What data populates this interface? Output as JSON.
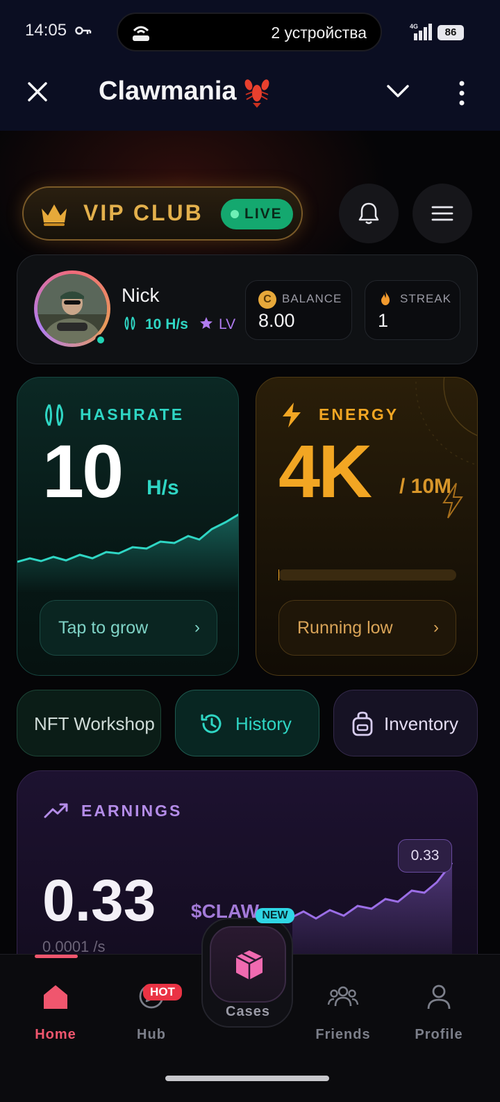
{
  "status_bar": {
    "time": "14:05",
    "devices_text": "2 устройства",
    "network": "4G",
    "battery": "86"
  },
  "app_header": {
    "title": "Clawmania",
    "emoji_icon": "lobster-icon"
  },
  "vip": {
    "label": "VIP CLUB",
    "live_label": "LIVE"
  },
  "profile": {
    "name": "Nick",
    "hashrate": "10 H/s",
    "level": "LV",
    "balance_label": "BALANCE",
    "balance_value": "8.00",
    "streak_label": "STREAK",
    "streak_value": "1",
    "coin_letter": "C"
  },
  "hashrate_card": {
    "label": "HASHRATE",
    "value": "10",
    "unit": "H/s",
    "action_label": "Tap to grow",
    "arrow": "›"
  },
  "energy_card": {
    "label": "ENERGY",
    "value": "4K",
    "max": "/ 10M",
    "level_fraction": 0.0004,
    "action_label": "Running low",
    "arrow": "›"
  },
  "quick_actions": [
    {
      "label": "NFT Workshop"
    },
    {
      "label": "History"
    },
    {
      "label": "Inventory"
    }
  ],
  "earnings": {
    "label": "EARNINGS",
    "value": "0.33",
    "unit": "$CLAW",
    "rate": "0.0001 /s",
    "badge": "0.33"
  },
  "nav": {
    "home": "Home",
    "hub": "Hub",
    "hot_badge": "HOT",
    "cases": "Cases",
    "new_badge": "NEW",
    "friends": "Friends",
    "profile": "Profile"
  },
  "colors": {
    "teal": "#2fd6c4",
    "gold": "#f2a623",
    "purple": "#b07cf0",
    "pink": "#f0566e"
  }
}
